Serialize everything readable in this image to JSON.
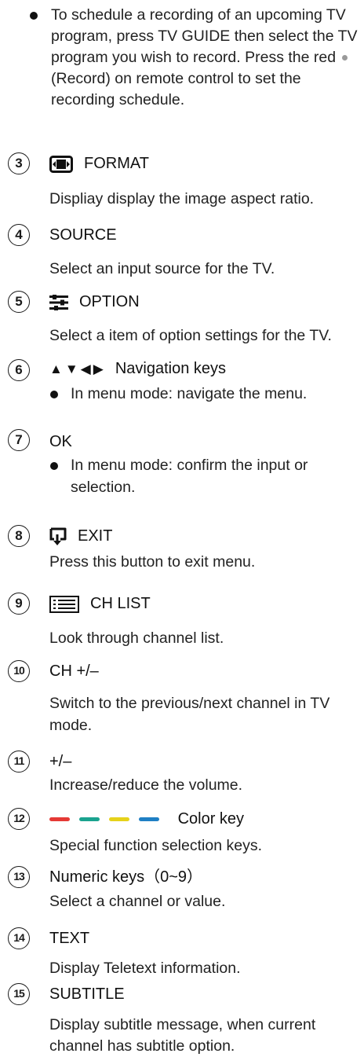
{
  "intro": {
    "text_before": "To schedule a recording of an upcoming TV program, press TV GUIDE then select the TV program you wish to record. Press the red",
    "text_after": "(Record) on remote control to set the recording schedule."
  },
  "items": [
    {
      "num": "3",
      "title": "FORMAT",
      "icon": "format-icon",
      "desc": "Displiay display the image aspect ratio."
    },
    {
      "num": "4",
      "title": "SOURCE",
      "desc": "Select an input  source  for the TV."
    },
    {
      "num": "5",
      "title": "OPTION",
      "icon": "option-sliders-icon",
      "desc": "Select a item of option settings for the TV."
    },
    {
      "num": "6",
      "arrows": "▲▼◀▶",
      "title": "Navigation keys",
      "bullet": "In menu mode:  navigate the menu."
    },
    {
      "num": "7",
      "title": "OK",
      "bullet": "In menu mode:  confirm the input or selection."
    },
    {
      "num": "8",
      "title": "EXIT",
      "icon": "exit-icon",
      "desc": "Press this button to exit menu."
    },
    {
      "num": "9",
      "title": "CH LIST",
      "icon": "list-icon",
      "desc": "Look through channel list."
    },
    {
      "num": "10",
      "title": "CH +/–",
      "desc": "Switch to the previous/next channel in TV mode."
    },
    {
      "num": "11",
      "title": "+/–",
      "desc": "Increase/reduce the volume."
    },
    {
      "num": "12",
      "title": "Color key",
      "desc": "Special function selection keys."
    },
    {
      "num": "13",
      "title": "Numeric keys（0~9）",
      "desc": "Select a channel or value."
    },
    {
      "num": "14",
      "title": "TEXT",
      "desc": "Display Teletext information."
    },
    {
      "num": "15",
      "title": "SUBTITLE",
      "desc": "Display subtitle message, when current channel has subtitle option."
    }
  ],
  "colors": {
    "color_key_red": "#e53935",
    "color_key_green": "#1aa38f",
    "color_key_yellow": "#e6d21a",
    "color_key_blue": "#1f7fc4",
    "record_dot": "#9a9a9a"
  }
}
